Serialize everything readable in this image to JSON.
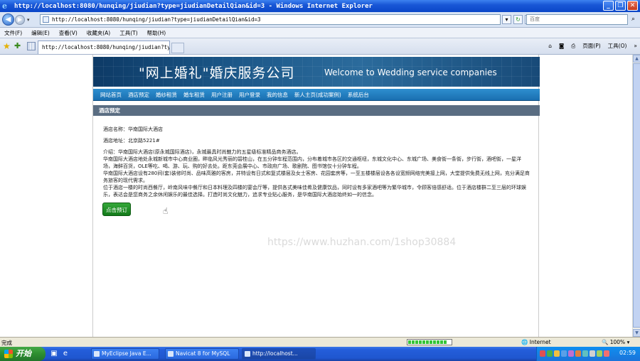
{
  "window": {
    "title": "http://localhost:8080/hunqing/jiudian?type=jiudianDetailQian&id=3 - Windows Internet Explorer"
  },
  "address": {
    "url": "http://localhost:8080/hunqing/jiudian?type=jiudianDetailQian&id=3",
    "search_placeholder": "百度"
  },
  "menu": [
    "文件(F)",
    "编辑(E)",
    "查看(V)",
    "收藏夹(A)",
    "工具(T)",
    "帮助(H)"
  ],
  "tab": {
    "label": "http://localhost:8080/hunqing/jiudian?typ..."
  },
  "command_bar": {
    "page_label": "页面(P)",
    "tools_label": "工具(O)"
  },
  "site": {
    "banner_cn": "\"网上婚礼\"婚庆服务公司",
    "banner_en": "Welcome to Wedding service companies",
    "nav": [
      "网站首页",
      "酒店预定",
      "婚纱租赁",
      "婚车租赁",
      "用户注册",
      "用户登录",
      "我的信息",
      "新人主页(成功案例)",
      "系统后台"
    ],
    "section_title": "酒店预定",
    "hotel": {
      "name_line": "酒店名称：华南国际大酒店",
      "address_line": "酒店地址：北京路5221#",
      "intro_lines": [
        "介绍：华南国际大酒店(原永城国际酒店)，永城最具时尚魅力的五星级标准精品商务酒店。",
        "华南国际大酒店地处永城新城市中心商业圈，畔临风光秀丽的碧桂山，在五分钟车程范围内，分布着城市各区的交通枢纽，东城文化中心、东城广场、美食街一条街，步行街，酒吧街，一星洋场，海鲜百货，OLE等吃、喝、游、玩、购的好去处。距东莞会展中心、市政府广场、歌剧院、图书馆仅十分钟车程。",
        "华南国际大酒店设有280间(套)装修时尚、品味高雅的客房，并特设有日式和复式楼层及女士客房、花园套房等，一至五楼楼层设各各设宽频网络完美接上网，大堂提供免费无线上网，充分满足商务旅客的现代需求。",
        "位于酒店一楼的时尚西餐厅，岭南风味中餐厅和日本料理及四楼的宴会厅等，提供各式美味佳肴及健康饮品，同时设有多家酒吧等为繁华城市，令顾客倍感舒适。位于酒店楼群二至三层的环球娱乐，表达会是您商务之余休闲娱乐的最佳选择。打造时尚文化魅力，追求专业贴心服务，是华南国际大酒店始终如一的信念。"
      ],
      "book_button": "点击预订"
    }
  },
  "status": {
    "text": "完成",
    "zone": "Internet",
    "zoom": "100%",
    "progress": 0.9
  },
  "taskbar": {
    "start": "开始",
    "items": [
      "MyEclipse Java E...",
      "Navicat 8 for MySQL",
      "http://localhost..."
    ],
    "clock": "02:59"
  },
  "watermark": "https://www.huzhan.com/1shop30884",
  "colors": {
    "title_bar": "#0a46c8",
    "banner": "#1b5687",
    "nav": "#1a6fb0",
    "section_head": "#5a6d82",
    "book_button": "#137a1a",
    "taskbar": "#245edb"
  }
}
